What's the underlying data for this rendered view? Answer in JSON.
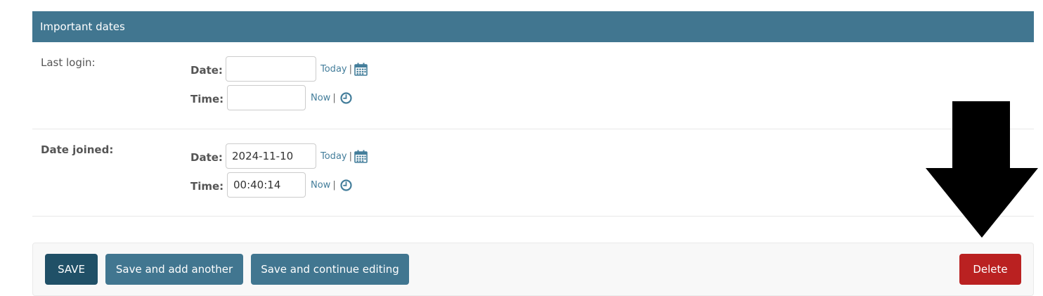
{
  "fieldset": {
    "title": "Important dates",
    "rows": [
      {
        "label": "Last login:",
        "date_label": "Date:",
        "date_value": "",
        "today_link": "Today",
        "time_label": "Time:",
        "time_value": "",
        "now_link": "Now"
      },
      {
        "label": "Date joined:",
        "date_label": "Date:",
        "date_value": "2024-11-10",
        "today_link": "Today",
        "time_label": "Time:",
        "time_value": "00:40:14",
        "now_link": "Now"
      }
    ],
    "separator": "|"
  },
  "actions": {
    "save": "SAVE",
    "save_add": "Save and add another",
    "save_continue": "Save and continue editing",
    "delete": "Delete"
  },
  "colors": {
    "header_bg": "#417690",
    "save_bg": "#205067",
    "button_bg": "#417690",
    "delete_bg": "#ba2121",
    "link": "#447e9b",
    "annotation_arrow": "#000000"
  },
  "icons": [
    "calendar-icon",
    "clock-icon",
    "down-arrow-annotation"
  ]
}
